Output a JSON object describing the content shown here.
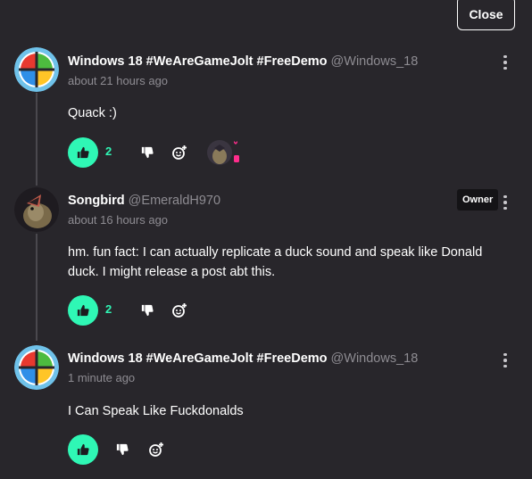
{
  "close_label": "Close",
  "colors": {
    "accent": "#2ff7b5",
    "background": "#28262b",
    "muted": "#8e8c92"
  },
  "comments": [
    {
      "author": "Windows 18 #WeAreGameJolt #FreeDemo",
      "handle": "@Windows_18",
      "time": "about 21 hours ago",
      "text": "Quack :)",
      "likes": "2",
      "avatar_icon": "windows-logo-avatar",
      "has_reaction": true
    },
    {
      "author": "Songbird",
      "handle": "@EmeraldH970",
      "time": "about 16 hours ago",
      "text": "hm. fun fact: I can actually replicate a duck sound and speak like Donald duck. I might release a post abt this.",
      "likes": "2",
      "badge": "Owner",
      "avatar_icon": "bird-avatar"
    },
    {
      "author": "Windows 18 #WeAreGameJolt #FreeDemo",
      "handle": "@Windows_18",
      "time": "1 minute ago",
      "text": "I Can Speak Like Fuckdonalds",
      "likes": "",
      "avatar_icon": "windows-logo-avatar"
    }
  ]
}
